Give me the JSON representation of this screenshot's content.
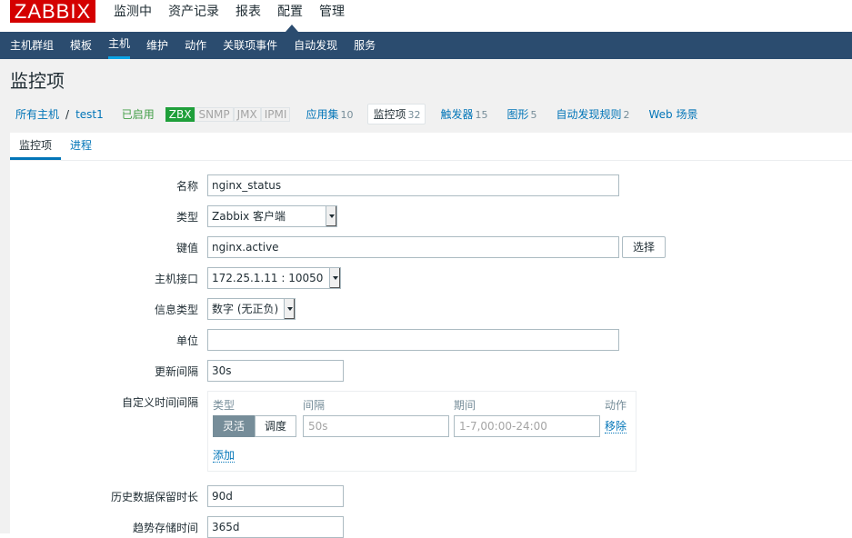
{
  "header": {
    "logo": "ZABBIX",
    "menu": [
      "监测中",
      "资产记录",
      "报表",
      "配置",
      "管理"
    ],
    "active_menu_index": 3
  },
  "subnav": {
    "items": [
      "主机群组",
      "模板",
      "主机",
      "维护",
      "动作",
      "关联项事件",
      "自动发现",
      "服务"
    ],
    "active_index": 2
  },
  "page": {
    "title": "监控项"
  },
  "breadcrumb": {
    "all_hosts": "所有主机",
    "separator": "/",
    "host": "test1",
    "status": "已启用",
    "badges": [
      {
        "label": "ZBX",
        "active": true
      },
      {
        "label": "SNMP",
        "active": false
      },
      {
        "label": "JMX",
        "active": false
      },
      {
        "label": "IPMI",
        "active": false
      }
    ],
    "links": [
      {
        "label": "应用集",
        "count": "10"
      },
      {
        "label": "监控项",
        "count": "32"
      },
      {
        "label": "触发器",
        "count": "15"
      },
      {
        "label": "图形",
        "count": "5"
      },
      {
        "label": "自动发现规则",
        "count": "2"
      },
      {
        "label": "Web 场景",
        "count": ""
      }
    ]
  },
  "tabs": [
    "监控项",
    "进程"
  ],
  "form": {
    "name_label": "名称",
    "name_value": "nginx_status",
    "type_label": "类型",
    "type_value": "Zabbix 客户端",
    "key_label": "键值",
    "key_value": "nginx.active",
    "select_button": "选择",
    "interface_label": "主机接口",
    "interface_value": "172.25.1.11 : 10050",
    "info_type_label": "信息类型",
    "info_type_value": "数字 (无正负)",
    "unit_label": "单位",
    "unit_value": "",
    "update_interval_label": "更新间隔",
    "update_interval_value": "30s",
    "custom_interval_label": "自定义时间间隔",
    "custom_interval": {
      "col_type": "类型",
      "col_interval": "间隔",
      "col_period": "期间",
      "col_action": "动作",
      "flexible": "灵活",
      "scheduling": "调度",
      "interval_placeholder": "50s",
      "period_placeholder": "1-7,00:00-24:00",
      "remove": "移除",
      "add": "添加"
    },
    "history_label": "历史数据保留时长",
    "history_value": "90d",
    "trends_label": "趋势存储时间",
    "trends_value": "365d"
  }
}
